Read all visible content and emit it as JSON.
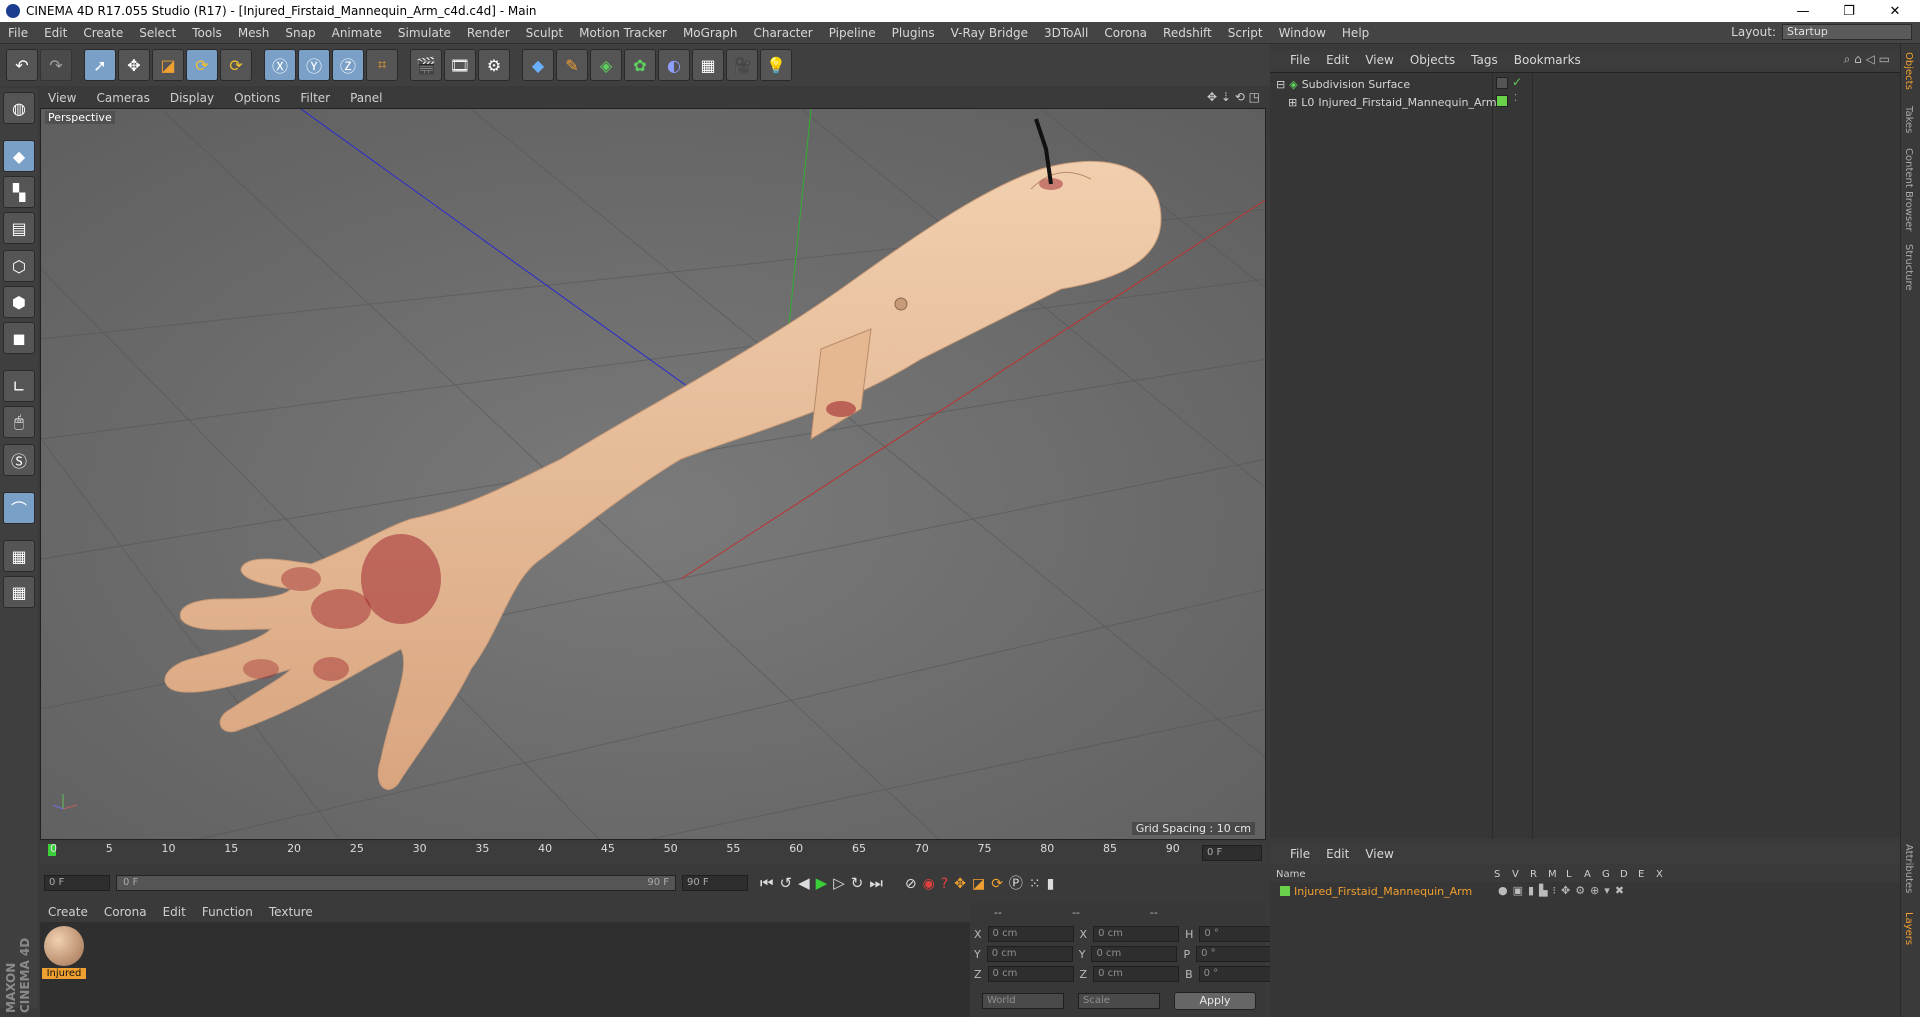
{
  "window": {
    "title": "CINEMA 4D R17.055 Studio (R17) - [Injured_Firstaid_Mannequin_Arm_c4d.c4d] - Main",
    "minimize": "—",
    "restore": "❐",
    "close": "✕"
  },
  "menubar": {
    "items": [
      "File",
      "Edit",
      "Create",
      "Select",
      "Tools",
      "Mesh",
      "Snap",
      "Animate",
      "Simulate",
      "Render",
      "Sculpt",
      "Motion Tracker",
      "MoGraph",
      "Character",
      "Pipeline",
      "Plugins",
      "V-Ray Bridge",
      "3DToAll",
      "Corona",
      "Redshift",
      "Script",
      "Window",
      "Help"
    ],
    "layout_label": "Layout:",
    "layout_value": "Startup"
  },
  "viewport": {
    "menu": [
      "View",
      "Cameras",
      "Display",
      "Options",
      "Filter",
      "Panel"
    ],
    "camera_label": "Perspective",
    "grid_spacing": "Grid Spacing : 10 cm"
  },
  "timeline": {
    "ticks": [
      "0",
      "5",
      "10",
      "15",
      "20",
      "25",
      "30",
      "35",
      "40",
      "45",
      "50",
      "55",
      "60",
      "65",
      "70",
      "75",
      "80",
      "85",
      "90"
    ],
    "current_frame": "0 F",
    "start_field": "0 F",
    "range_start": "0 F",
    "range_end": "90 F",
    "end_field": "90 F"
  },
  "material_manager": {
    "menu": [
      "Create",
      "Corona",
      "Edit",
      "Function",
      "Texture"
    ],
    "materials": [
      {
        "name": "Injured"
      }
    ]
  },
  "coordinates": {
    "headers": [
      "--",
      "--",
      "--"
    ],
    "rows": [
      {
        "a": "X",
        "av": "0 cm",
        "b": "X",
        "bv": "0 cm",
        "c": "H",
        "cv": "0 °"
      },
      {
        "a": "Y",
        "av": "0 cm",
        "b": "Y",
        "bv": "0 cm",
        "c": "P",
        "cv": "0 °"
      },
      {
        "a": "Z",
        "av": "0 cm",
        "b": "Z",
        "bv": "0 cm",
        "c": "B",
        "cv": "0 °"
      }
    ],
    "space": "World",
    "mode": "Scale",
    "apply": "Apply"
  },
  "object_manager": {
    "menu": [
      "File",
      "Edit",
      "View",
      "Objects",
      "Tags",
      "Bookmarks"
    ],
    "objects": [
      {
        "name": "Subdivision Surface"
      },
      {
        "name": "Injured_Firstaid_Mannequin_Arm"
      }
    ]
  },
  "layer_manager": {
    "menu": [
      "File",
      "Edit",
      "View"
    ],
    "columns": [
      "Name",
      "S",
      "V",
      "R",
      "M",
      "L",
      "A",
      "G",
      "D",
      "E",
      "X"
    ],
    "layers": [
      {
        "name": "Injured_Firstaid_Mannequin_Arm"
      }
    ]
  },
  "right_tabs": [
    "Objects",
    "Takes",
    "Content Browser",
    "Structure",
    "Attributes",
    "Layers"
  ],
  "brand": "MAXON CINEMA 4D",
  "colors": {
    "accent_orange": "#f0a030",
    "layer_green": "#6ad14a",
    "skin": "#e8bc95"
  }
}
